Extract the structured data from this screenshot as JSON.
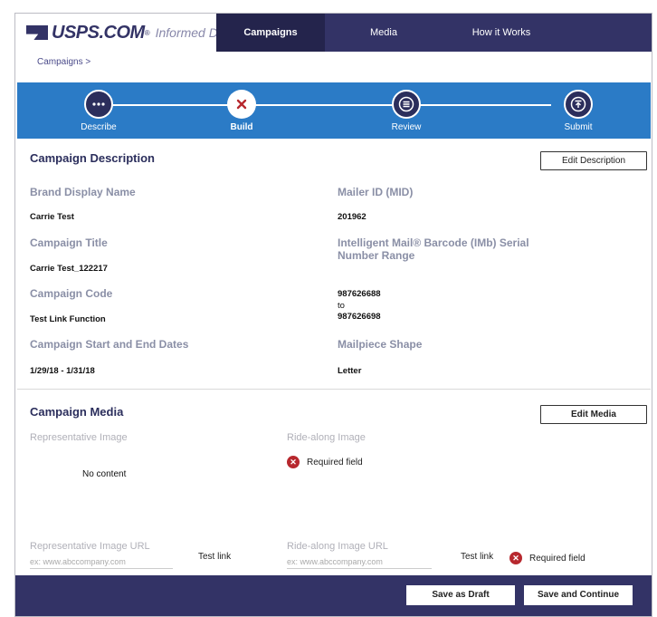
{
  "header": {
    "logo_text": "USPS.COM",
    "logo_registered": "®",
    "logo_sub": "Informed Delivery",
    "logo_sub_registered": "®",
    "nav": [
      "Campaigns",
      "Media",
      "How it Works"
    ]
  },
  "breadcrumb": "Campaigns >",
  "stepper": {
    "steps": [
      {
        "label": "Describe",
        "icon": "more-icon"
      },
      {
        "label": "Build",
        "icon": "close-icon"
      },
      {
        "label": "Review",
        "icon": "list-icon"
      },
      {
        "label": "Submit",
        "icon": "upload-icon"
      }
    ],
    "active_index": 1
  },
  "description": {
    "title": "Campaign Description",
    "edit_button": "Edit Description",
    "brand_label": "Brand Display Name",
    "brand_value": "Carrie Test",
    "title_label": "Campaign Title",
    "title_value": "Carrie Test_122217",
    "code_label": "Campaign Code",
    "code_value": "Test Link Function",
    "dates_label": "Campaign Start and End Dates",
    "dates_value": "1/29/18 - 1/31/18",
    "mid_label": "Mailer ID (MID)",
    "mid_value": "201962",
    "imb_label": "Intelligent Mail® Barcode (IMb) Serial Number Range",
    "imb_from": "987626688",
    "imb_to_word": "to",
    "imb_to": "987626698",
    "shape_label": "Mailpiece Shape",
    "shape_value": "Letter"
  },
  "media": {
    "title": "Campaign Media",
    "edit_button": "Edit Media",
    "rep_label": "Representative Image",
    "rep_value": "No content",
    "ride_label": "Ride-along Image",
    "required": "Required field",
    "rep_url_label": "Representative Image URL",
    "rep_url_placeholder": "ex: www.abccompany.com",
    "ride_url_label": "Ride-along Image URL",
    "ride_url_placeholder": "ex: www.abccompany.com",
    "test_link": "Test link"
  },
  "footer": {
    "save_draft": "Save as Draft",
    "save_continue": "Save and Continue"
  },
  "colors": {
    "navy": "#333366",
    "stepper_blue": "#2b7bc6",
    "error_red": "#b7282e"
  }
}
